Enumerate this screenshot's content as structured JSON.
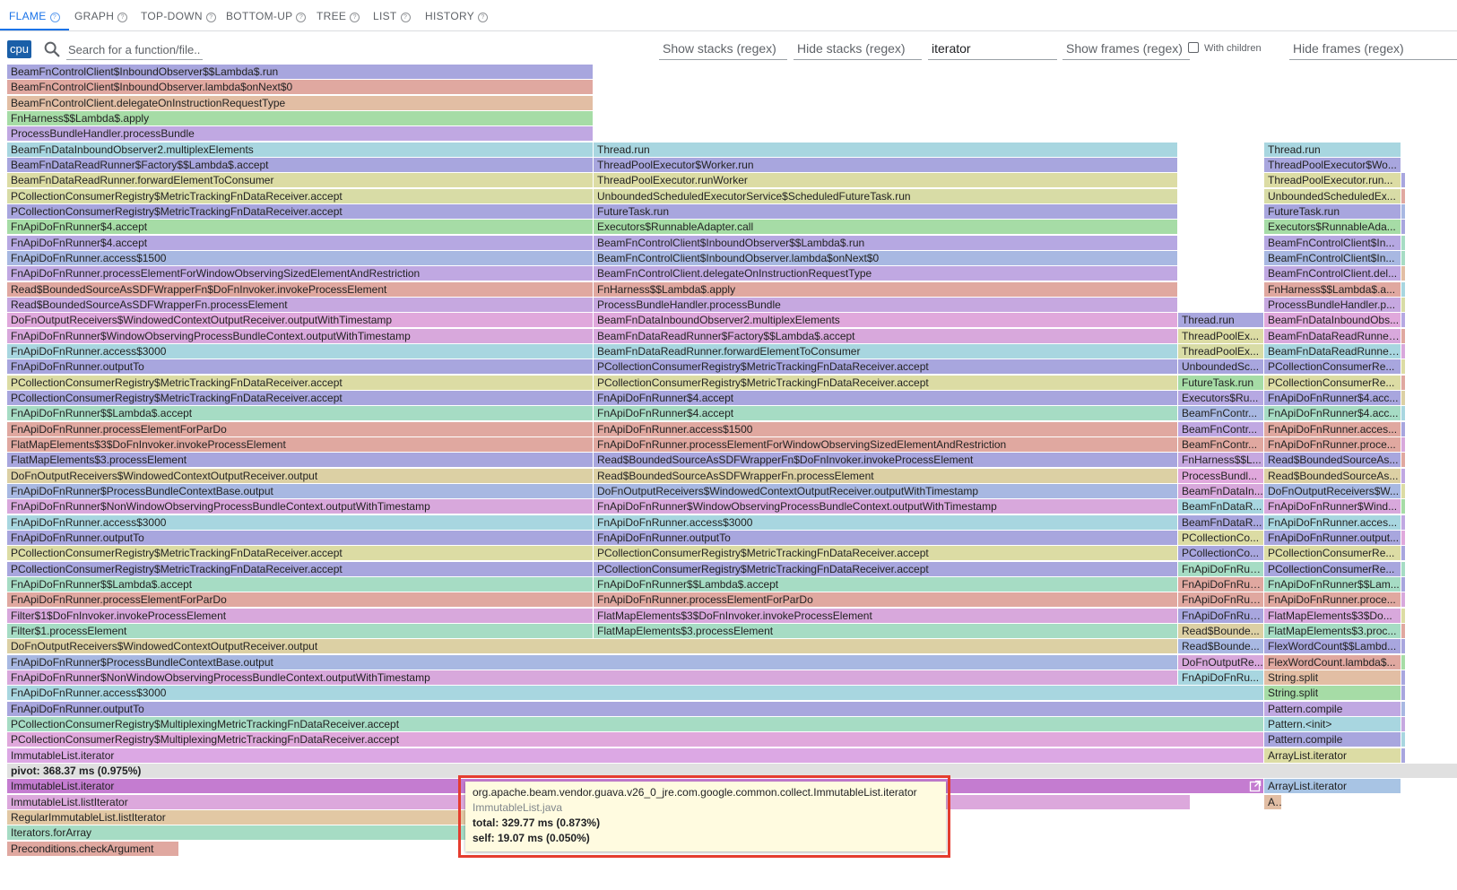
{
  "tabs": [
    {
      "label": "FLAME",
      "active": true
    },
    {
      "label": "GRAPH"
    },
    {
      "label": "TOP-DOWN"
    },
    {
      "label": "BOTTOM-UP"
    },
    {
      "label": "TREE"
    },
    {
      "label": "LIST"
    },
    {
      "label": "HISTORY"
    }
  ],
  "toolbar": {
    "profile_type": "cpu",
    "search_placeholder": "Search for a function/file..",
    "show_stacks_placeholder": "Show stacks (regex)",
    "hide_stacks_placeholder": "Hide stacks (regex)",
    "hide_stacks_value": "iterator",
    "show_frames_placeholder": "Show frames (regex)",
    "with_children_label": "With children",
    "hide_frames_placeholder": "Hide frames (regex)"
  },
  "pivot_label": "pivot: 368.37 ms (0.975%)",
  "tooltip": {
    "function": "org.apache.beam.vendor.guava.v26_0_jre.com.google.common.collect.ImmutableList.iterator",
    "file": "ImmutableList.java",
    "total": "total: 329.77 ms (0.873%)",
    "self": "self: 19.07 ms (0.050%)"
  },
  "colors": {
    "accent": "#1a73e8",
    "cpu_badge": "#1a5fa8",
    "highlight_border": "#e53d2f",
    "tooltip_bg": "#fffbe0"
  },
  "icons": {
    "search": "search-icon",
    "help": "help-circle-icon",
    "open": "open-in-new-icon"
  },
  "columns": {
    "left": [
      "BeamFnControlClient$InboundObserver$$Lambda$.run",
      "BeamFnControlClient$InboundObserver.lambda$onNext$0",
      "BeamFnControlClient.delegateOnInstructionRequestType",
      "FnHarness$$Lambda$.apply",
      "ProcessBundleHandler.processBundle",
      "BeamFnDataInboundObserver2.multiplexElements",
      "BeamFnDataReadRunner$Factory$$Lambda$.accept",
      "BeamFnDataReadRunner.forwardElementToConsumer",
      "PCollectionConsumerRegistry$MetricTrackingFnDataReceiver.accept",
      "PCollectionConsumerRegistry$MetricTrackingFnDataReceiver.accept",
      "FnApiDoFnRunner$4.accept",
      "FnApiDoFnRunner$4.accept",
      "FnApiDoFnRunner.access$1500",
      "FnApiDoFnRunner.processElementForWindowObservingSizedElementAndRestriction",
      "Read$BoundedSourceAsSDFWrapperFn$DoFnInvoker.invokeProcessElement",
      "Read$BoundedSourceAsSDFWrapperFn.processElement",
      "DoFnOutputReceivers$WindowedContextOutputReceiver.outputWithTimestamp",
      "FnApiDoFnRunner$WindowObservingProcessBundleContext.outputWithTimestamp",
      "FnApiDoFnRunner.access$3000",
      "FnApiDoFnRunner.outputTo",
      "PCollectionConsumerRegistry$MetricTrackingFnDataReceiver.accept",
      "PCollectionConsumerRegistry$MetricTrackingFnDataReceiver.accept",
      "FnApiDoFnRunner$$Lambda$.accept",
      "FnApiDoFnRunner.processElementForParDo",
      "FlatMapElements$3$DoFnInvoker.invokeProcessElement",
      "FlatMapElements$3.processElement",
      "DoFnOutputReceivers$WindowedContextOutputReceiver.output",
      "FnApiDoFnRunner$ProcessBundleContextBase.output",
      "FnApiDoFnRunner$NonWindowObservingProcessBundleContext.outputWithTimestamp",
      "FnApiDoFnRunner.access$3000",
      "FnApiDoFnRunner.outputTo",
      "PCollectionConsumerRegistry$MetricTrackingFnDataReceiver.accept",
      "PCollectionConsumerRegistry$MetricTrackingFnDataReceiver.accept",
      "FnApiDoFnRunner$$Lambda$.accept",
      "FnApiDoFnRunner.processElementForParDo",
      "Filter$1$DoFnInvoker.invokeProcessElement",
      "Filter$1.processElement"
    ],
    "wide": [
      "DoFnOutputReceivers$WindowedContextOutputReceiver.output",
      "FnApiDoFnRunner$ProcessBundleContextBase.output",
      "FnApiDoFnRunner$NonWindowObservingProcessBundleContext.outputWithTimestamp",
      "FnApiDoFnRunner.access$3000",
      "FnApiDoFnRunner.outputTo",
      "PCollectionConsumerRegistry$MultiplexingMetricTrackingFnDataReceiver.accept",
      "PCollectionConsumerRegistry$MultiplexingMetricTrackingFnDataReceiver.accept",
      "ImmutableList.iterator"
    ],
    "middle": [
      "Thread.run",
      "ThreadPoolExecutor$Worker.run",
      "ThreadPoolExecutor.runWorker",
      "UnboundedScheduledExecutorService$ScheduledFutureTask.run",
      "FutureTask.run",
      "Executors$RunnableAdapter.call",
      "BeamFnControlClient$InboundObserver$$Lambda$.run",
      "BeamFnControlClient$InboundObserver.lambda$onNext$0",
      "BeamFnControlClient.delegateOnInstructionRequestType",
      "FnHarness$$Lambda$.apply",
      "ProcessBundleHandler.processBundle",
      "BeamFnDataInboundObserver2.multiplexElements",
      "BeamFnDataReadRunner$Factory$$Lambda$.accept",
      "BeamFnDataReadRunner.forwardElementToConsumer",
      "PCollectionConsumerRegistry$MetricTrackingFnDataReceiver.accept",
      "PCollectionConsumerRegistry$MetricTrackingFnDataReceiver.accept",
      "FnApiDoFnRunner$4.accept",
      "FnApiDoFnRunner$4.accept",
      "FnApiDoFnRunner.access$1500",
      "FnApiDoFnRunner.processElementForWindowObservingSizedElementAndRestriction",
      "Read$BoundedSourceAsSDFWrapperFn$DoFnInvoker.invokeProcessElement",
      "Read$BoundedSourceAsSDFWrapperFn.processElement",
      "DoFnOutputReceivers$WindowedContextOutputReceiver.outputWithTimestamp",
      "FnApiDoFnRunner$WindowObservingProcessBundleContext.outputWithTimestamp",
      "FnApiDoFnRunner.access$3000",
      "FnApiDoFnRunner.outputTo",
      "PCollectionConsumerRegistry$MetricTrackingFnDataReceiver.accept",
      "PCollectionConsumerRegistry$MetricTrackingFnDataReceiver.accept",
      "FnApiDoFnRunner$$Lambda$.accept",
      "FnApiDoFnRunner.processElementForParDo",
      "FlatMapElements$3$DoFnInvoker.invokeProcessElement",
      "FlatMapElements$3.processElement"
    ],
    "narrow": [
      "Thread.run",
      "ThreadPoolEx...",
      "ThreadPoolEx...",
      "UnboundedSc...",
      "FutureTask.run",
      "Executors$Ru...",
      "BeamFnContr...",
      "BeamFnContr...",
      "BeamFnContr...",
      "FnHarness$$L...",
      "ProcessBundl...",
      "BeamFnDataIn...",
      "BeamFnDataR...",
      "BeamFnDataR...",
      "PCollectionCo...",
      "PCollectionCo...",
      "FnApiDoFnRun...",
      "FnApiDoFnRun...",
      "FnApiDoFnRun...",
      "FnApiDoFnRun...",
      "Read$Bounde...",
      "Read$Bounde...",
      "DoFnOutputRe...",
      "FnApiDoFnRu..."
    ],
    "right": [
      "Thread.run",
      "ThreadPoolExecutor$Wo...",
      "ThreadPoolExecutor.run...",
      "UnboundedScheduledEx...",
      "FutureTask.run",
      "Executors$RunnableAda...",
      "BeamFnControlClient$In...",
      "BeamFnControlClient$In...",
      "BeamFnControlClient.del...",
      "FnHarness$$Lambda$.a...",
      "ProcessBundleHandler.p...",
      "BeamFnDataInboundObs...",
      "BeamFnDataReadRunner...",
      "BeamFnDataReadRunner...",
      "PCollectionConsumerRe...",
      "PCollectionConsumerRe...",
      "FnApiDoFnRunner$4.acc...",
      "FnApiDoFnRunner$4.acc...",
      "FnApiDoFnRunner.acces...",
      "FnApiDoFnRunner.proce...",
      "Read$BoundedSourceAs...",
      "Read$BoundedSourceAs...",
      "DoFnOutputReceivers$W...",
      "FnApiDoFnRunner$Wind...",
      "FnApiDoFnRunner.acces...",
      "FnApiDoFnRunner.output...",
      "PCollectionConsumerRe...",
      "PCollectionConsumerRe...",
      "FnApiDoFnRunner$$Lam...",
      "FnApiDoFnRunner.proce...",
      "FlatMapElements$3$Do...",
      "FlatMapElements$3.proc...",
      "FlexWordCount$$Lambd...",
      "FlexWordCount.lambda$...",
      "String.split",
      "String.split",
      "Pattern.compile",
      "Pattern.<init>",
      "Pattern.compile",
      "ArrayList.iterator"
    ],
    "bottom_left": [
      "ImmutableList.iterator",
      "ImmutableList.listIterator",
      "RegularImmutableList.listIterator",
      "Iterators.forArray",
      "Preconditions.checkArgument"
    ],
    "bottom_right": [
      "ArrayList.iterator",
      "A..."
    ]
  }
}
